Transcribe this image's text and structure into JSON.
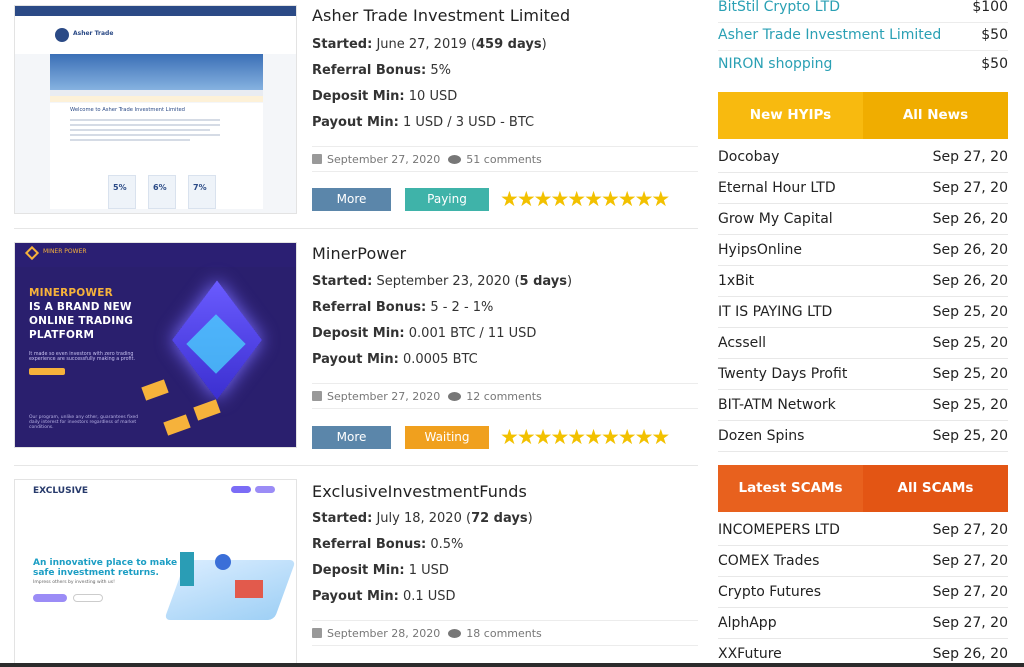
{
  "listings": [
    {
      "title": "Asher Trade Investment Limited",
      "started_label": "Started:",
      "started_value": "June 27, 2019",
      "started_days": "459 days",
      "referral_label": "Referral Bonus:",
      "referral_value": "5%",
      "deposit_label": "Deposit Min:",
      "deposit_value": "10 USD",
      "payout_label": "Payout Min:",
      "payout_value": "1 USD / 3 USD - BTC",
      "date": "September 27, 2020",
      "comments": "51 comments",
      "more_label": "More",
      "status_label": "Paying",
      "status_color": "#3fb3a9",
      "rating": 10,
      "thumb": {
        "logo": "Asher Trade",
        "welcome": "Welcome to Asher Trade Investment Limited",
        "pct1": "5%",
        "pct2": "6%",
        "pct3": "7%"
      }
    },
    {
      "title": "MinerPower",
      "started_label": "Started:",
      "started_value": "September 23, 2020",
      "started_days": "5 days",
      "referral_label": "Referral Bonus:",
      "referral_value": "5 - 2 - 1%",
      "deposit_label": "Deposit Min:",
      "deposit_value": "0.001 BTC / 11 USD",
      "payout_label": "Payout Min:",
      "payout_value": "0.0005 BTC",
      "date": "September 27, 2020",
      "comments": "12 comments",
      "more_label": "More",
      "status_label": "Waiting",
      "status_color": "#f0a01e",
      "rating": 10,
      "thumb": {
        "brand": "MINER POWER",
        "line1": "MINERPOWER",
        "line2": "IS A BRAND NEW",
        "line3": "ONLINE TRADING",
        "line4": "PLATFORM",
        "sub": "It made so even investors with zero trading experience are successfully making a profit.",
        "foot": "Our program, unlike any other, guarantees fixed daily interest for investors regardless of market conditions."
      }
    },
    {
      "title": "ExclusiveInvestmentFunds",
      "started_label": "Started:",
      "started_value": "July 18, 2020",
      "started_days": "72 days",
      "referral_label": "Referral Bonus:",
      "referral_value": "0.5%",
      "deposit_label": "Deposit Min:",
      "deposit_value": "1 USD",
      "payout_label": "Payout Min:",
      "payout_value": "0.1 USD",
      "date": "September 28, 2020",
      "comments": "18 comments",
      "thumb": {
        "logo": "EXCLUSIVE",
        "head1": "An innovative place to make",
        "head2": "safe investment returns.",
        "sub": "Impress others by investing with us!"
      }
    }
  ],
  "top_list": [
    {
      "name": "BitStil Crypto LTD",
      "amount": "$100"
    },
    {
      "name": "Asher Trade Investment Limited",
      "amount": "$50"
    },
    {
      "name": "NIRON shopping",
      "amount": "$50"
    }
  ],
  "new_hyips": {
    "tab_a": "New HYIPs",
    "tab_b": "All News",
    "items": [
      {
        "name": "Docobay",
        "date": "Sep 27, 20"
      },
      {
        "name": "Eternal Hour LTD",
        "date": "Sep 27, 20"
      },
      {
        "name": "Grow My Capital",
        "date": "Sep 26, 20"
      },
      {
        "name": "HyipsOnline",
        "date": "Sep 26, 20"
      },
      {
        "name": "1xBit",
        "date": "Sep 26, 20"
      },
      {
        "name": "IT IS PAYING LTD",
        "date": "Sep 25, 20"
      },
      {
        "name": "Acssell",
        "date": "Sep 25, 20"
      },
      {
        "name": "Twenty Days Profit",
        "date": "Sep 25, 20"
      },
      {
        "name": "BIT-ATM Network",
        "date": "Sep 25, 20"
      },
      {
        "name": "Dozen Spins",
        "date": "Sep 25, 20"
      }
    ]
  },
  "latest_scams": {
    "tab_a": "Latest SCAMs",
    "tab_b": "All SCAMs",
    "items": [
      {
        "name": "INCOMEPERS LTD",
        "date": "Sep 27, 20"
      },
      {
        "name": "COMEX Trades",
        "date": "Sep 27, 20"
      },
      {
        "name": "Crypto Futures",
        "date": "Sep 27, 20"
      },
      {
        "name": "AlphApp",
        "date": "Sep 27, 20"
      },
      {
        "name": "XXFuture",
        "date": "Sep 26, 20"
      }
    ]
  },
  "colors": {
    "link": "#2aa0b4",
    "more_button": "#5b86aa",
    "paying": "#3fb3a9",
    "waiting": "#f0a01e",
    "star": "#f2c100",
    "new_hyips_tab": "#f8ba0f",
    "scams_tab": "#e8611e"
  },
  "icons": {
    "date": "calendar-icon",
    "comments": "comments-icon",
    "rating": "star-icon"
  }
}
